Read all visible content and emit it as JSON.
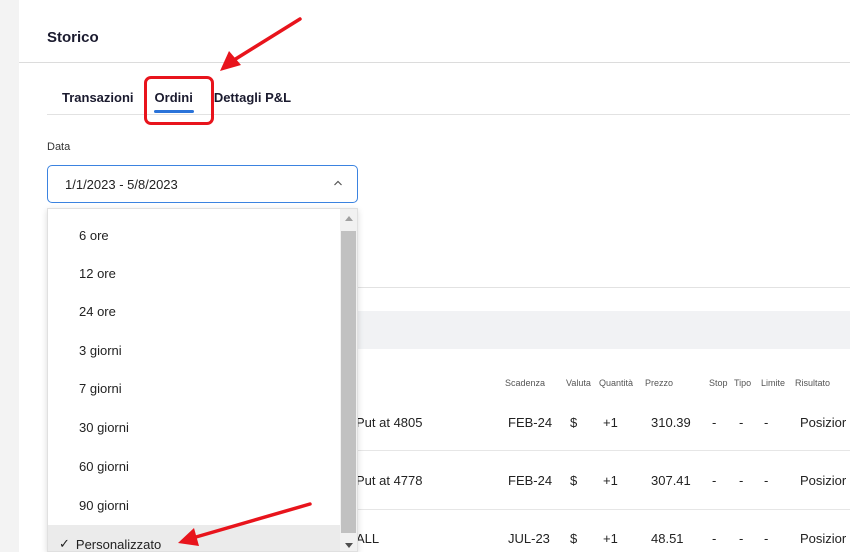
{
  "header": {
    "title": "Storico"
  },
  "tabs": [
    {
      "label": "Transazioni",
      "active": false
    },
    {
      "label": "Ordini",
      "active": true
    },
    {
      "label": "Dettagli P&L",
      "active": false
    }
  ],
  "date_filter": {
    "label": "Data",
    "value": "1/1/2023 - 5/8/2023"
  },
  "dropdown": {
    "options": [
      "6 ore",
      "12 ore",
      "24 ore",
      "3 giorni",
      "7 giorni",
      "30 giorni",
      "60 giorni",
      "90 giorni",
      "Personalizzato"
    ],
    "selected": "Personalizzato",
    "check_glyph": "✓"
  },
  "table": {
    "headers": [
      "Scadenza",
      "Valuta",
      "Quantità",
      "Prezzo",
      "Stop",
      "Tipo",
      "Limite",
      "Risultato"
    ],
    "rows": [
      {
        "name": "Put at 4805",
        "expiry": "FEB-24",
        "currency": "$",
        "qty": "+1",
        "price": "310.39",
        "stop": "-",
        "type": "-",
        "limit": "-",
        "result": "Posizior"
      },
      {
        "name": "Put at 4778",
        "expiry": "FEB-24",
        "currency": "$",
        "qty": "+1",
        "price": "307.41",
        "stop": "-",
        "type": "-",
        "limit": "-",
        "result": "Posizior"
      },
      {
        "name": "ALL",
        "expiry": "JUL-23",
        "currency": "$",
        "qty": "+1",
        "price": "48.51",
        "stop": "-",
        "type": "-",
        "limit": "-",
        "result": "Posizior"
      }
    ]
  },
  "colors": {
    "accent": "#2a73d9",
    "annotation": "#e8141c",
    "selected_bg": "#ebebeb"
  },
  "icons": {
    "select_chevron": "chevron-up-icon"
  }
}
